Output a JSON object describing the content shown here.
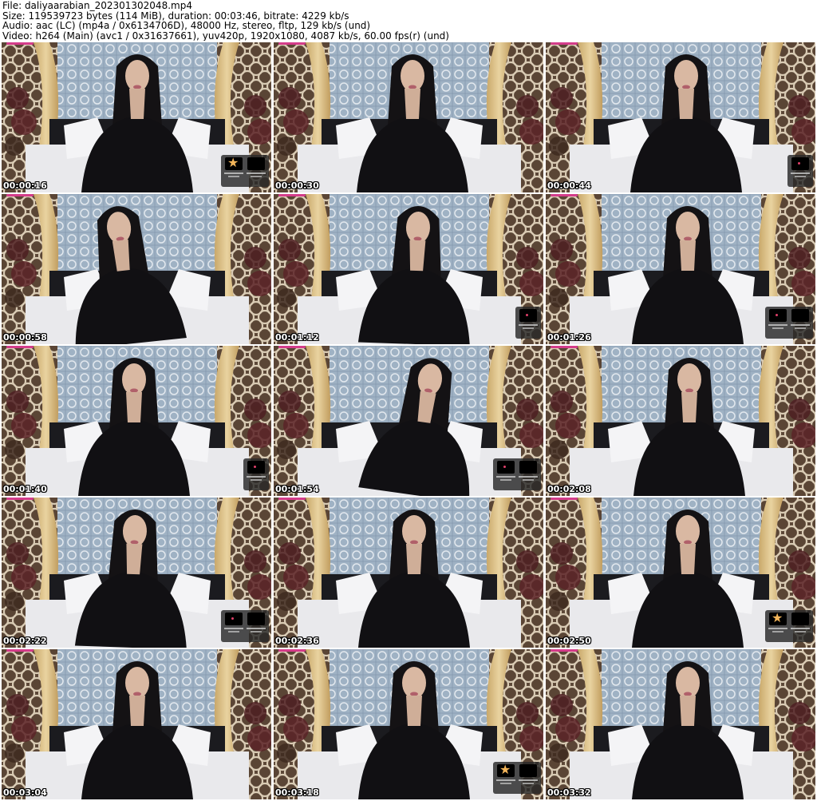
{
  "header": {
    "file": "File: daliyaarabian_202301302048.mp4",
    "size": "Size: 119539723 bytes (114 MiB), duration: 00:03:46, bitrate: 4229 kb/s",
    "audio": "Audio: aac (LC) (mp4a / 0x6134706D), 48000 Hz, stereo, fltp, 129 kb/s (und)",
    "video": "Video: h264 (Main) (avc1 / 0x31637661), yuv420p, 1920x1080, 4087 kb/s, 60.00 fps(r) (und)"
  },
  "thumbnails": [
    {
      "time": "00:00:16",
      "tip": "star-two"
    },
    {
      "time": "00:00:30",
      "tip": "none"
    },
    {
      "time": "00:00:44",
      "tip": "one"
    },
    {
      "time": "00:00:58",
      "tip": "none"
    },
    {
      "time": "00:01:12",
      "tip": "one"
    },
    {
      "time": "00:01:26",
      "tip": "two"
    },
    {
      "time": "00:01:40",
      "tip": "one"
    },
    {
      "time": "00:01:54",
      "tip": "two"
    },
    {
      "time": "00:02:08",
      "tip": "none"
    },
    {
      "time": "00:02:22",
      "tip": "two"
    },
    {
      "time": "00:02:36",
      "tip": "none"
    },
    {
      "time": "00:02:50",
      "tip": "star-two"
    },
    {
      "time": "00:03:04",
      "tip": "none"
    },
    {
      "time": "00:03:18",
      "tip": "star-two"
    },
    {
      "time": "00:03:32",
      "tip": "none"
    }
  ]
}
